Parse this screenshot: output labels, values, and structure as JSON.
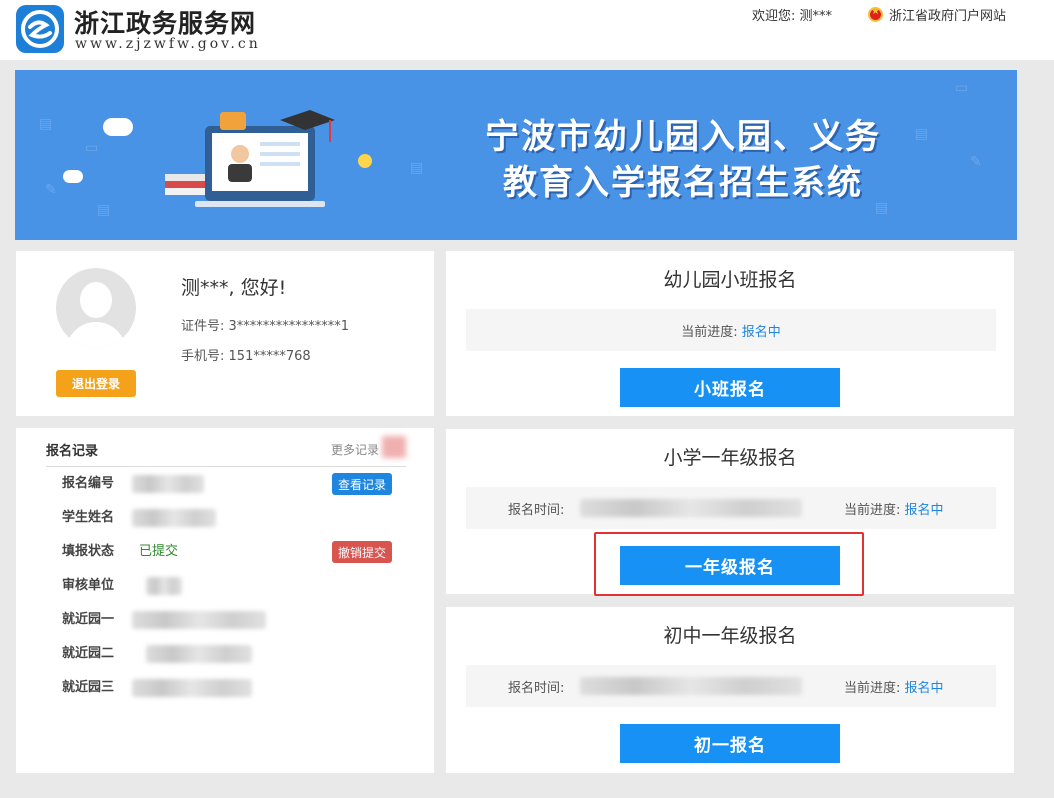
{
  "header": {
    "site_title": "浙江政务服务网",
    "site_url": "www.zjzwfw.gov.cn",
    "welcome": "欢迎您:  测***",
    "portal_link": "浙江省政府门户网站"
  },
  "banner": {
    "line1": "宁波市幼儿园入园、义务",
    "line2": "教育入学报名招生系统"
  },
  "profile": {
    "greeting": "测***,  您好!",
    "id_label": "证件号:",
    "id_value": "3****************1",
    "phone_label": "手机号:",
    "phone_value": "151*****768",
    "logout_label": "退出登录"
  },
  "records": {
    "title": "报名记录",
    "more": "更多记录",
    "rows": [
      {
        "label": "报名编号",
        "value": "",
        "action": "查看记录"
      },
      {
        "label": "学生姓名",
        "value": ""
      },
      {
        "label": "填报状态",
        "value": "已提交",
        "action": "撤销提交"
      },
      {
        "label": "审核单位",
        "value": ""
      },
      {
        "label": "就近园一",
        "value": ""
      },
      {
        "label": "就近园二",
        "value": ""
      },
      {
        "label": "就近园三",
        "value": ""
      }
    ]
  },
  "registrations": [
    {
      "title": "幼儿园小班报名",
      "progress_label": "当前进度:",
      "progress_value": "报名中",
      "button": "小班报名"
    },
    {
      "title": "小学一年级报名",
      "time_label": "报名时间:",
      "progress_label": "当前进度:",
      "progress_value": "报名中",
      "button": "一年级报名"
    },
    {
      "title": "初中一年级报名",
      "time_label": "报名时间:",
      "progress_label": "当前进度:",
      "progress_value": "报名中",
      "button": "初一报名"
    }
  ],
  "colors": {
    "banner": "#4993e7",
    "primary_button": "#1891f5",
    "logout_button": "#f5a21b",
    "cancel_button": "#d9534f",
    "highlight_border": "#e23232"
  }
}
